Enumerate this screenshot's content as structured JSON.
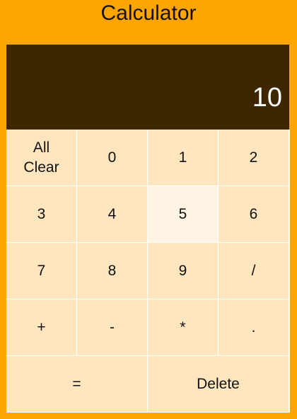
{
  "app": {
    "title": "Calculator"
  },
  "display": {
    "value": "10"
  },
  "keys": {
    "all_clear": "All\nClear",
    "k0": "0",
    "k1": "1",
    "k2": "2",
    "k3": "3",
    "k4": "4",
    "k5": "5",
    "k6": "6",
    "k7": "7",
    "k8": "8",
    "k9": "9",
    "divide": "/",
    "plus": "+",
    "minus": "-",
    "multiply": "*",
    "decimal": ".",
    "equals": "=",
    "delete": "Delete"
  },
  "colors": {
    "background": "#ffa500",
    "display_bg": "#3d2600",
    "key_bg": "#ffe6bf",
    "key_hover_bg": "#fff4e3"
  }
}
